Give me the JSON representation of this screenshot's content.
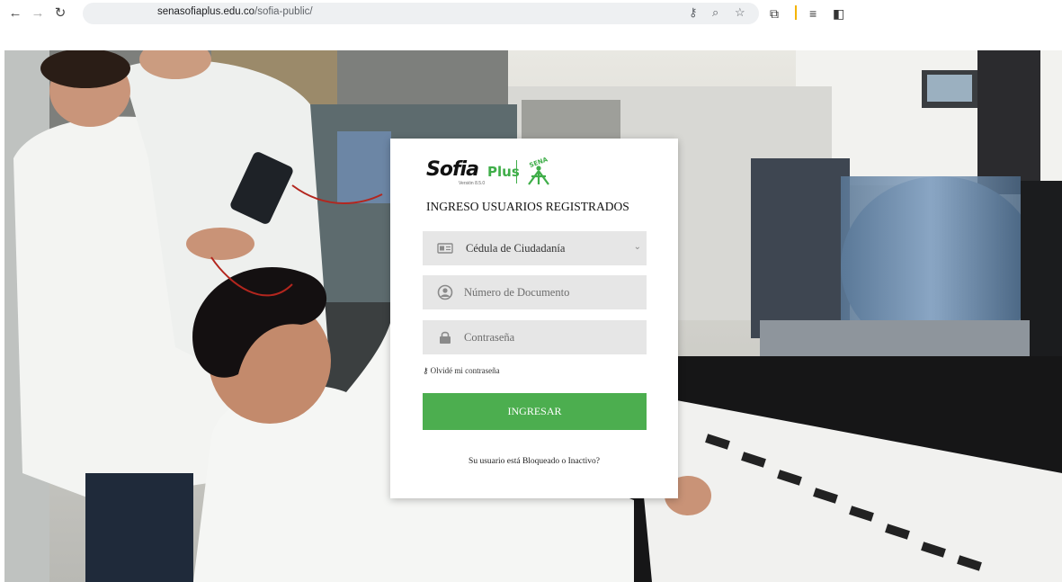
{
  "browser": {
    "url_host": "senasofiaplus.edu.co",
    "url_path": "/sofia-public/"
  },
  "login": {
    "logo_sofia": "Sofia",
    "logo_plus": "Plus",
    "logo_version": "Versión 8.5.0",
    "logo_sena": "SENA",
    "title": "INGRESO USUARIOS REGISTRADOS",
    "doc_type": {
      "selected": "Cédula de Ciudadanía",
      "icon": "id-card-icon"
    },
    "doc_number": {
      "placeholder": "Número de Documento",
      "icon": "user-circle-icon"
    },
    "password": {
      "placeholder": "Contraseña",
      "icon": "lock-icon"
    },
    "forgot_label": "Olvidé mi contraseña",
    "submit_label": "INGRESAR",
    "blocked_label": "Su usuario está Bloqueado o Inactivo?"
  },
  "colors": {
    "accent": "#4cae4f",
    "field_bg": "#e6e6e6"
  }
}
